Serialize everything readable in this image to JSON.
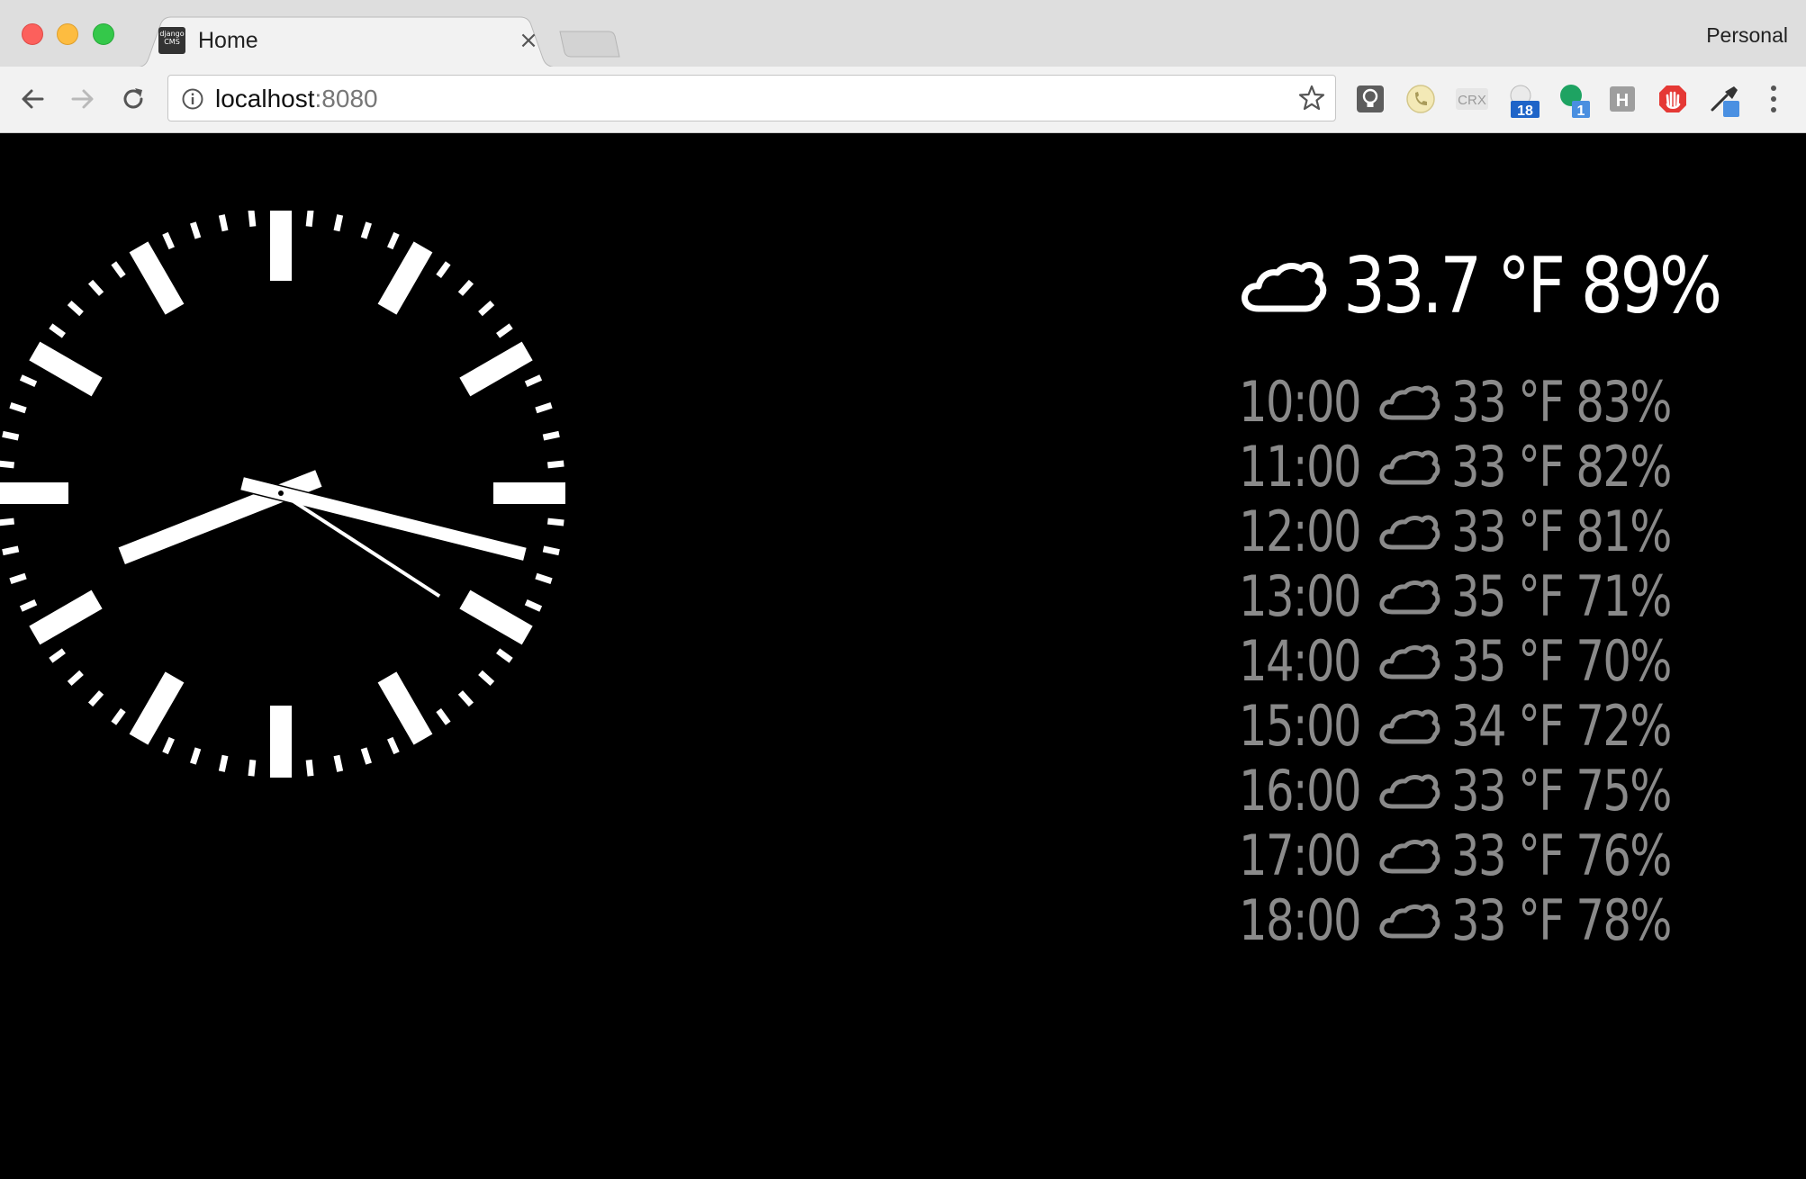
{
  "browser": {
    "tab": {
      "title": "Home",
      "favicon_text": "django CMS",
      "close_glyph": "×"
    },
    "profile": "Personal",
    "omnibox": {
      "host": "localhost",
      "port": ":8080"
    },
    "extensions": [
      {
        "name": "lightbulb-extension-icon"
      },
      {
        "name": "phone-extension-icon"
      },
      {
        "name": "crx-extension-icon",
        "label": "CRX"
      },
      {
        "name": "calendar-extension-icon",
        "badge": "18"
      },
      {
        "name": "hangouts-extension-icon",
        "badge": "1"
      },
      {
        "name": "h-extension-icon",
        "label": "H"
      },
      {
        "name": "adblock-extension-icon"
      },
      {
        "name": "eyedropper-extension-icon"
      }
    ]
  },
  "clock": {
    "hour": 8,
    "minute": 17,
    "second": 20.5
  },
  "current_weather": {
    "icon": "cloud-icon",
    "text": "33.7 °F 89%"
  },
  "forecast": [
    {
      "time": "10:00",
      "icon": "cloud-icon",
      "values": "33 °F 83%"
    },
    {
      "time": "11:00",
      "icon": "cloud-icon",
      "values": "33 °F 82%"
    },
    {
      "time": "12:00",
      "icon": "cloud-icon",
      "values": "33 °F 81%"
    },
    {
      "time": "13:00",
      "icon": "cloud-icon",
      "values": "35 °F 71%"
    },
    {
      "time": "14:00",
      "icon": "cloud-icon",
      "values": "35 °F 70%"
    },
    {
      "time": "15:00",
      "icon": "cloud-icon",
      "values": "34 °F 72%"
    },
    {
      "time": "16:00",
      "icon": "cloud-icon",
      "values": "33 °F 75%"
    },
    {
      "time": "17:00",
      "icon": "cloud-icon",
      "values": "33 °F 76%"
    },
    {
      "time": "18:00",
      "icon": "cloud-icon",
      "values": "33 °F 78%"
    }
  ],
  "colors": {
    "background": "#000000",
    "primary_text": "#ffffff",
    "forecast_text": "#8a8a8a"
  }
}
